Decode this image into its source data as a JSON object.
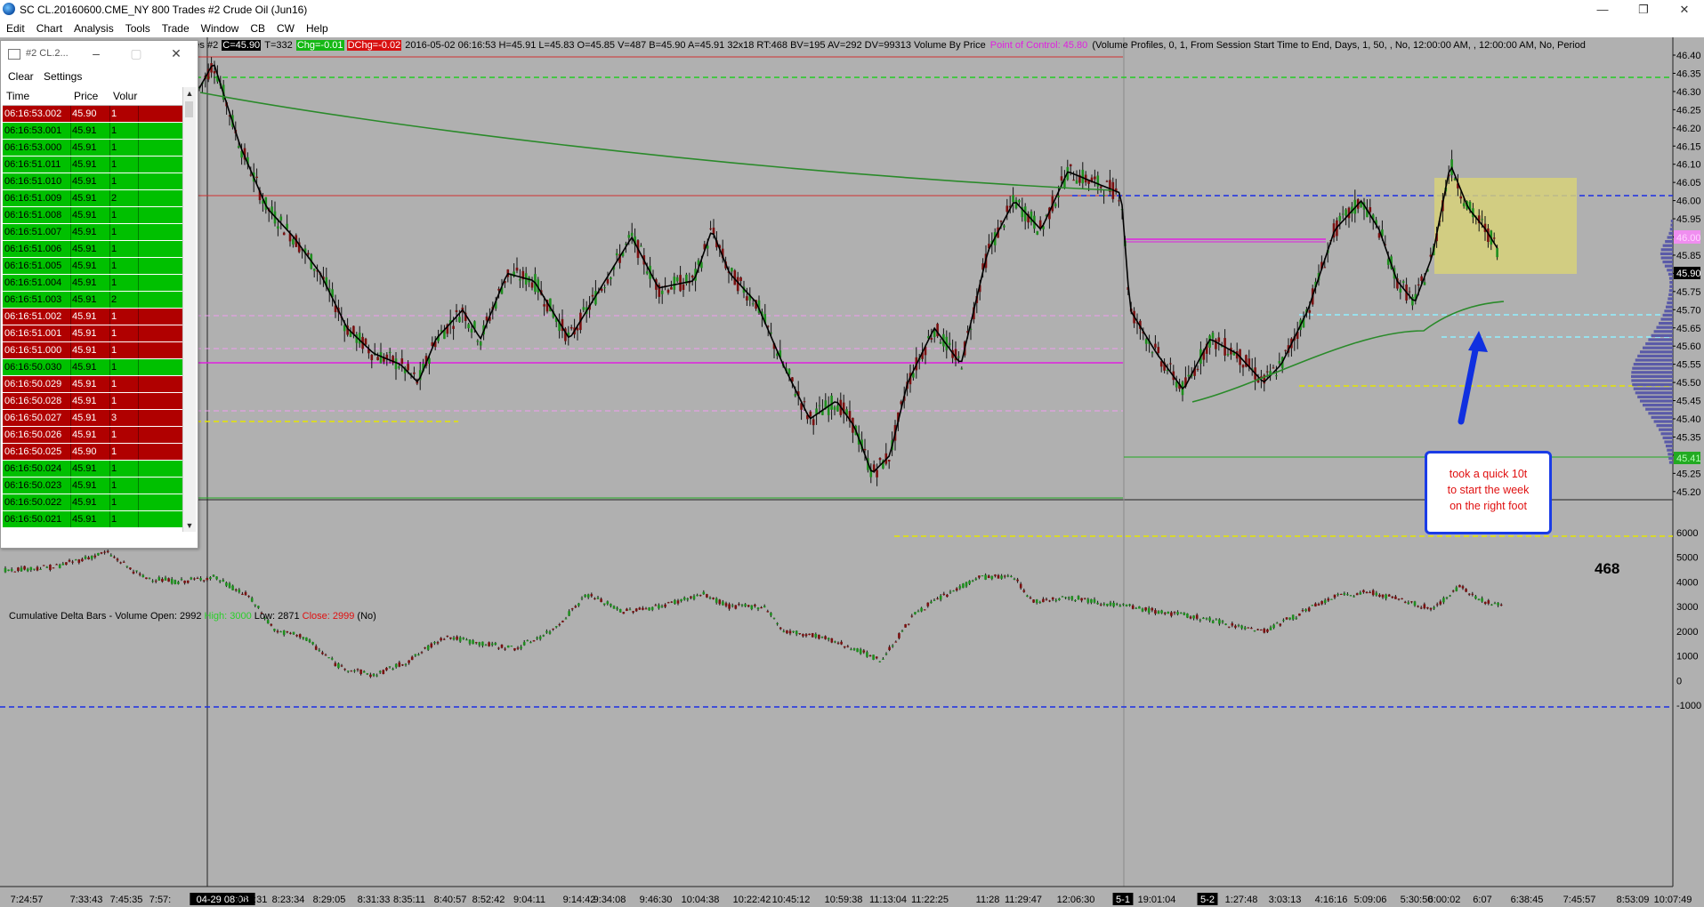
{
  "window": {
    "title": "SC CL.20160600.CME_NY  800 Trades  #2  Crude Oil (Jun16)",
    "controls": [
      "—",
      "❐",
      "✕"
    ]
  },
  "menu": [
    "Edit",
    "Chart",
    "Analysis",
    "Tools",
    "Trade",
    "Window",
    "CB",
    "CW",
    "Help"
  ],
  "infobar": {
    "prefix": "00 Trades  #2",
    "close": "C=45.90",
    "mid": "T=332",
    "chg": "Chg=-0.01",
    "dchg": "DChg=-0.02",
    "stats": "2016-05-02 06:16:53 H=45.91 L=45.83 O=45.85 V=487 B=45.90 A=45.91 32x18 RT:468 BV=195 AV=292 DV=99313 Volume By Price",
    "poc": "Point of Control: 45.80",
    "tail": "(Volume Profiles, 0, 1, From Session Start Time to End, Days, 1, 50, , No, 12:00:00 AM, , 12:00:00 AM, No, Period"
  },
  "lower_panel": {
    "label": "Cumulative Delta Bars - Volume  Open: 2992",
    "high": "High: 3000",
    "low": "Low: 2871",
    "close": "Close: 2999",
    "tail": "(No)"
  },
  "time_and_sales": {
    "title": "#2 CL.2...",
    "toolbar": [
      "Clear",
      "Settings"
    ],
    "columns": [
      "Time",
      "Price",
      "Volur"
    ],
    "rows": [
      {
        "time": "06:16:53.002",
        "price": "45.90",
        "vol": "1",
        "side": "sell"
      },
      {
        "time": "06:16:53.001",
        "price": "45.91",
        "vol": "1",
        "side": "buy"
      },
      {
        "time": "06:16:53.000",
        "price": "45.91",
        "vol": "1",
        "side": "buy"
      },
      {
        "time": "06:16:51.011",
        "price": "45.91",
        "vol": "1",
        "side": "buy"
      },
      {
        "time": "06:16:51.010",
        "price": "45.91",
        "vol": "1",
        "side": "buy"
      },
      {
        "time": "06:16:51.009",
        "price": "45.91",
        "vol": "2",
        "side": "buy"
      },
      {
        "time": "06:16:51.008",
        "price": "45.91",
        "vol": "1",
        "side": "buy"
      },
      {
        "time": "06:16:51.007",
        "price": "45.91",
        "vol": "1",
        "side": "buy"
      },
      {
        "time": "06:16:51.006",
        "price": "45.91",
        "vol": "1",
        "side": "buy"
      },
      {
        "time": "06:16:51.005",
        "price": "45.91",
        "vol": "1",
        "side": "buy"
      },
      {
        "time": "06:16:51.004",
        "price": "45.91",
        "vol": "1",
        "side": "buy"
      },
      {
        "time": "06:16:51.003",
        "price": "45.91",
        "vol": "2",
        "side": "buy"
      },
      {
        "time": "06:16:51.002",
        "price": "45.91",
        "vol": "1",
        "side": "sell"
      },
      {
        "time": "06:16:51.001",
        "price": "45.91",
        "vol": "1",
        "side": "sell"
      },
      {
        "time": "06:16:51.000",
        "price": "45.91",
        "vol": "1",
        "side": "sell"
      },
      {
        "time": "06:16:50.030",
        "price": "45.91",
        "vol": "1",
        "side": "buy"
      },
      {
        "time": "06:16:50.029",
        "price": "45.91",
        "vol": "1",
        "side": "sell"
      },
      {
        "time": "06:16:50.028",
        "price": "45.91",
        "vol": "1",
        "side": "sell"
      },
      {
        "time": "06:16:50.027",
        "price": "45.91",
        "vol": "3",
        "side": "sell"
      },
      {
        "time": "06:16:50.026",
        "price": "45.91",
        "vol": "1",
        "side": "sell"
      },
      {
        "time": "06:16:50.025",
        "price": "45.90",
        "vol": "1",
        "side": "sell"
      },
      {
        "time": "06:16:50.024",
        "price": "45.91",
        "vol": "1",
        "side": "buy"
      },
      {
        "time": "06:16:50.023",
        "price": "45.91",
        "vol": "1",
        "side": "buy"
      },
      {
        "time": "06:16:50.022",
        "price": "45.91",
        "vol": "1",
        "side": "buy"
      },
      {
        "time": "06:16:50.021",
        "price": "45.91",
        "vol": "1",
        "side": "buy"
      }
    ]
  },
  "callout": {
    "line1": "took a quick 10t",
    "line2": "to start the week",
    "line3": "on the right foot"
  },
  "counter": "468",
  "price_axis": [
    "46.40",
    "46.35",
    "46.30",
    "46.25",
    "46.20",
    "46.15",
    "46.10",
    "46.05",
    "46.00",
    "45.95",
    "45.90",
    "45.85",
    "45.80",
    "45.75",
    "45.70",
    "45.65",
    "45.60",
    "45.55",
    "45.50",
    "45.45",
    "45.40",
    "45.35",
    "45.30",
    "45.25",
    "45.20"
  ],
  "price_badges": {
    "last": "45.90",
    "poc": "46.00",
    "low": "45.41"
  },
  "delta_axis": [
    "6000",
    "5000",
    "4000",
    "3000",
    "2000",
    "1000",
    "0",
    "-1000"
  ],
  "time_axis": [
    "7:24:57",
    "7:33:43",
    "7:45:35",
    "7:57:",
    "04-29 08:08",
    "8:18:31",
    "8:23:34",
    "8:29:05",
    "8:31:33",
    "8:35:11",
    "8:40:57",
    "8:52:42",
    "9:04:11",
    "9:14:42",
    "9:34:08",
    "9:46:30",
    "10:04:38",
    "10:22:42",
    "10:45:12",
    "10:59:38",
    "11:13:04",
    "11:22:25",
    "11:28",
    "11:29:47",
    "12:06:30",
    "5-1",
    "19:01:04",
    "5-2",
    "1:27:48",
    "3:03:13",
    "4:16:16",
    "5:09:06",
    "5:30:50",
    "6:00:02",
    "6:07",
    "6:38:45",
    "7:45:57",
    "8:53:09",
    "10:07:49"
  ],
  "colors": {
    "chart_bg": "#b0b0b0",
    "up_bar": "#1e8f1e",
    "down_bar": "#7a1010",
    "ma_black": "#000000",
    "ma_green": "#2a8a2a",
    "buy_row": "#00c000",
    "sell_row": "#b00000",
    "highlight_box": "#d8d27a",
    "callout_border": "#1a3ce6"
  }
}
